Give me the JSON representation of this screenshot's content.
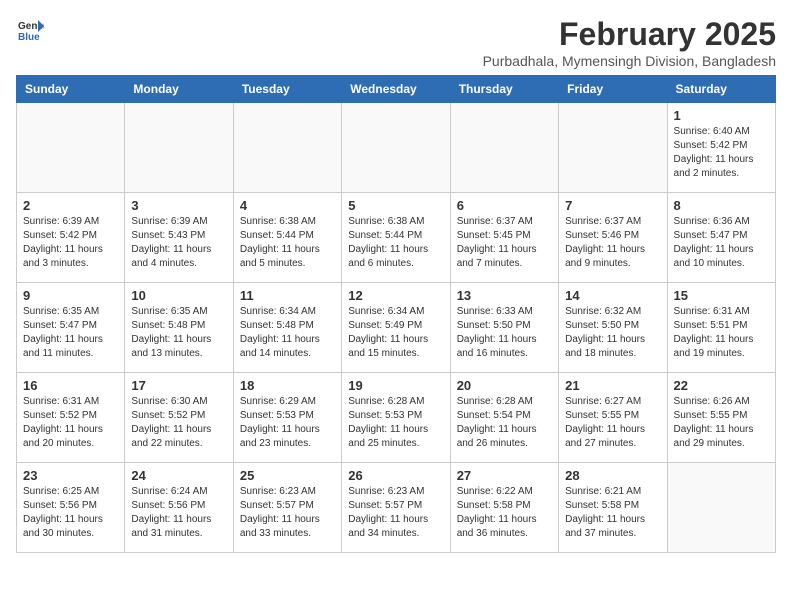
{
  "logo": {
    "general": "General",
    "blue": "Blue"
  },
  "title": "February 2025",
  "subtitle": "Purbadhala, Mymensingh Division, Bangladesh",
  "days_of_week": [
    "Sunday",
    "Monday",
    "Tuesday",
    "Wednesday",
    "Thursday",
    "Friday",
    "Saturday"
  ],
  "weeks": [
    [
      {
        "day": "",
        "info": ""
      },
      {
        "day": "",
        "info": ""
      },
      {
        "day": "",
        "info": ""
      },
      {
        "day": "",
        "info": ""
      },
      {
        "day": "",
        "info": ""
      },
      {
        "day": "",
        "info": ""
      },
      {
        "day": "1",
        "info": "Sunrise: 6:40 AM\nSunset: 5:42 PM\nDaylight: 11 hours and 2 minutes."
      }
    ],
    [
      {
        "day": "2",
        "info": "Sunrise: 6:39 AM\nSunset: 5:42 PM\nDaylight: 11 hours and 3 minutes."
      },
      {
        "day": "3",
        "info": "Sunrise: 6:39 AM\nSunset: 5:43 PM\nDaylight: 11 hours and 4 minutes."
      },
      {
        "day": "4",
        "info": "Sunrise: 6:38 AM\nSunset: 5:44 PM\nDaylight: 11 hours and 5 minutes."
      },
      {
        "day": "5",
        "info": "Sunrise: 6:38 AM\nSunset: 5:44 PM\nDaylight: 11 hours and 6 minutes."
      },
      {
        "day": "6",
        "info": "Sunrise: 6:37 AM\nSunset: 5:45 PM\nDaylight: 11 hours and 7 minutes."
      },
      {
        "day": "7",
        "info": "Sunrise: 6:37 AM\nSunset: 5:46 PM\nDaylight: 11 hours and 9 minutes."
      },
      {
        "day": "8",
        "info": "Sunrise: 6:36 AM\nSunset: 5:47 PM\nDaylight: 11 hours and 10 minutes."
      }
    ],
    [
      {
        "day": "9",
        "info": "Sunrise: 6:35 AM\nSunset: 5:47 PM\nDaylight: 11 hours and 11 minutes."
      },
      {
        "day": "10",
        "info": "Sunrise: 6:35 AM\nSunset: 5:48 PM\nDaylight: 11 hours and 13 minutes."
      },
      {
        "day": "11",
        "info": "Sunrise: 6:34 AM\nSunset: 5:48 PM\nDaylight: 11 hours and 14 minutes."
      },
      {
        "day": "12",
        "info": "Sunrise: 6:34 AM\nSunset: 5:49 PM\nDaylight: 11 hours and 15 minutes."
      },
      {
        "day": "13",
        "info": "Sunrise: 6:33 AM\nSunset: 5:50 PM\nDaylight: 11 hours and 16 minutes."
      },
      {
        "day": "14",
        "info": "Sunrise: 6:32 AM\nSunset: 5:50 PM\nDaylight: 11 hours and 18 minutes."
      },
      {
        "day": "15",
        "info": "Sunrise: 6:31 AM\nSunset: 5:51 PM\nDaylight: 11 hours and 19 minutes."
      }
    ],
    [
      {
        "day": "16",
        "info": "Sunrise: 6:31 AM\nSunset: 5:52 PM\nDaylight: 11 hours and 20 minutes."
      },
      {
        "day": "17",
        "info": "Sunrise: 6:30 AM\nSunset: 5:52 PM\nDaylight: 11 hours and 22 minutes."
      },
      {
        "day": "18",
        "info": "Sunrise: 6:29 AM\nSunset: 5:53 PM\nDaylight: 11 hours and 23 minutes."
      },
      {
        "day": "19",
        "info": "Sunrise: 6:28 AM\nSunset: 5:53 PM\nDaylight: 11 hours and 25 minutes."
      },
      {
        "day": "20",
        "info": "Sunrise: 6:28 AM\nSunset: 5:54 PM\nDaylight: 11 hours and 26 minutes."
      },
      {
        "day": "21",
        "info": "Sunrise: 6:27 AM\nSunset: 5:55 PM\nDaylight: 11 hours and 27 minutes."
      },
      {
        "day": "22",
        "info": "Sunrise: 6:26 AM\nSunset: 5:55 PM\nDaylight: 11 hours and 29 minutes."
      }
    ],
    [
      {
        "day": "23",
        "info": "Sunrise: 6:25 AM\nSunset: 5:56 PM\nDaylight: 11 hours and 30 minutes."
      },
      {
        "day": "24",
        "info": "Sunrise: 6:24 AM\nSunset: 5:56 PM\nDaylight: 11 hours and 31 minutes."
      },
      {
        "day": "25",
        "info": "Sunrise: 6:23 AM\nSunset: 5:57 PM\nDaylight: 11 hours and 33 minutes."
      },
      {
        "day": "26",
        "info": "Sunrise: 6:23 AM\nSunset: 5:57 PM\nDaylight: 11 hours and 34 minutes."
      },
      {
        "day": "27",
        "info": "Sunrise: 6:22 AM\nSunset: 5:58 PM\nDaylight: 11 hours and 36 minutes."
      },
      {
        "day": "28",
        "info": "Sunrise: 6:21 AM\nSunset: 5:58 PM\nDaylight: 11 hours and 37 minutes."
      },
      {
        "day": "",
        "info": ""
      }
    ]
  ]
}
